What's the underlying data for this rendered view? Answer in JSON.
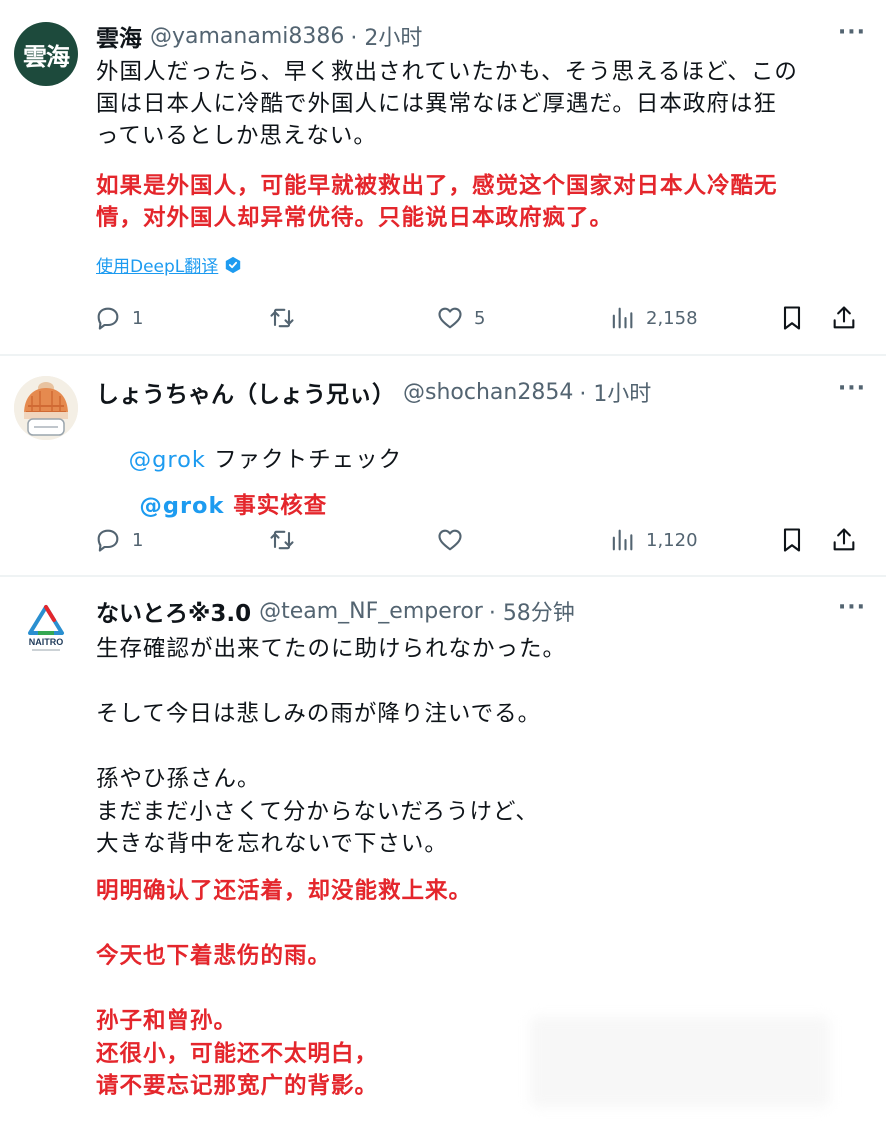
{
  "tweets": [
    {
      "avatar_text": "雲海",
      "name": "雲海",
      "handle": "@yamanami8386",
      "time": "· 2小时",
      "more": "···",
      "text": "外国人だったら、早く救出されていたかも、そう思えるほど、この\n国は日本人に冷酷で外国人には異常なほど厚遇だ。日本政府は狂\nっているとしか思えない。",
      "translation": "如果是外国人，可能早就被救出了，感觉这个国家对日本人冷酷无\n情，对外国人却异常优待。只能说日本政府疯了。",
      "deepl_label": "使用DeepL翻译",
      "replies": "1",
      "retweets": "",
      "likes": "5",
      "views": "2,158"
    },
    {
      "name": "しょうちゃん（しょう兄ぃ）",
      "handle": "@shochan2854",
      "time": "· 1小时",
      "more": "···",
      "mention": "@grok",
      "text": " ファクトチェック",
      "translation_mention": "@grok",
      "translation": " 事实核查",
      "replies": "1",
      "retweets": "",
      "likes": "",
      "views": "1,120"
    },
    {
      "avatar_text": "NAITRO",
      "name": "ないとろ※3.0",
      "handle": "@team_NF_emperor",
      "time": "· 58分钟",
      "more": "···",
      "text": "生存確認が出来てたのに助けられなかった。\n\nそして今日は悲しみの雨が降り注いでる。\n\n孫やひ孫さん。\nまだまだ小さくて分からないだろうけど、\n大きな背中を忘れないで下さい。",
      "translation": "明明确认了还活着，却没能救上来。\n\n今天也下着悲伤的雨。\n\n孙子和曾孙。\n还很小，可能还不太明白，\n请不要忘记那宽广的背影。"
    }
  ],
  "colors": {
    "accent": "#1d9bf0",
    "translation": "#e4262c",
    "muted": "#536471",
    "avatar1_bg": "#1d4a3c"
  }
}
